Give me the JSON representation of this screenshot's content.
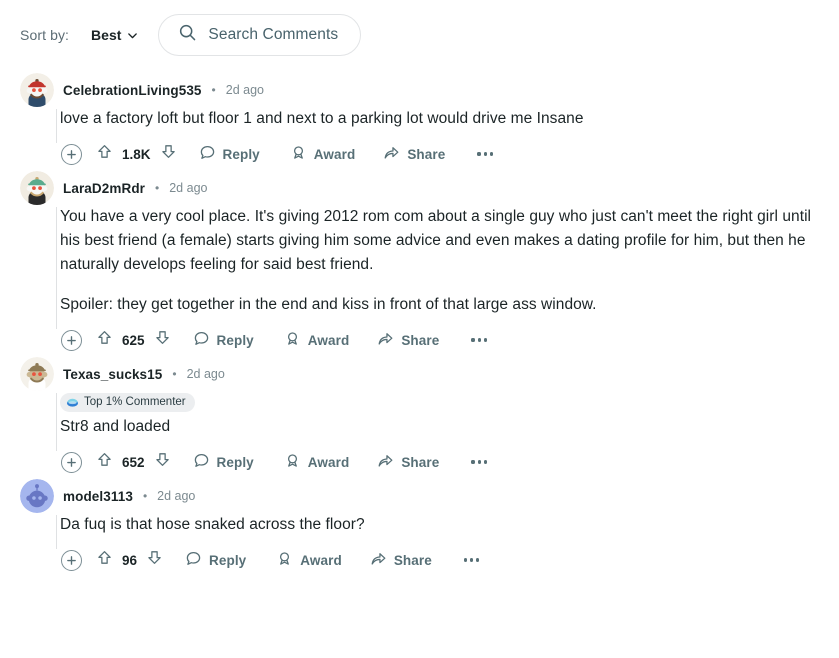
{
  "toolbar": {
    "sort_label": "Sort by:",
    "sort_value": "Best",
    "sort_chevron_icon": "chevron-down-icon",
    "search_icon": "search-icon",
    "search_placeholder": "Search Comments",
    "search_value": ""
  },
  "action_labels": {
    "reply": "Reply",
    "award": "Award",
    "share": "Share",
    "more": "more-options",
    "collapse": "collapse-thread",
    "upvote": "upvote-icon",
    "downvote": "downvote-icon"
  },
  "colors": {
    "text_primary": "#1b2426",
    "text_muted": "#576f76",
    "meta": "#7c8a90",
    "border": "#e2e4e6",
    "threadline": "#dfe1e3",
    "badge_bg": "#eceef0",
    "page_bg": "#ffffff"
  },
  "comments": [
    {
      "id": "c1",
      "author": "CelebrationLiving535",
      "separator": "•",
      "age": "2d ago",
      "badge": null,
      "paragraphs": [
        "love a factory loft but floor 1 and next to a parking lot would drive me Insane"
      ],
      "score": "1.8K",
      "avatar": {
        "name": "avatar-celebrationliving535",
        "bg": "#f3efe7",
        "body": "#2f4c6b",
        "skin": "#f6f6f4",
        "hat": "#c1342c",
        "hair": "#6b4b34"
      }
    },
    {
      "id": "c2",
      "author": "LaraD2mRdr",
      "separator": "•",
      "age": "2d ago",
      "badge": null,
      "paragraphs": [
        "You have a very cool place. It's giving 2012 rom com about a single guy who just can't meet the right girl until his best friend (a female) starts giving him some advice and even makes a dating profile for him, but then he naturally develops feeling for said best friend.",
        "Spoiler: they get together in the end and kiss in front of that large ass window."
      ],
      "score": "625",
      "avatar": {
        "name": "avatar-larad2mrdr",
        "bg": "#f1ece2",
        "body": "#2b2b2b",
        "skin": "#f7f7f5",
        "hat": "#5aab8e",
        "hair": "#c9a871"
      }
    },
    {
      "id": "c3",
      "author": "Texas_sucks15",
      "separator": "•",
      "age": "2d ago",
      "badge": {
        "label": "Top 1% Commenter",
        "icon": "top-commenter-icon"
      },
      "paragraphs": [
        "Str8 and loaded"
      ],
      "score": "652",
      "avatar": {
        "name": "avatar-texas-sucks15",
        "bg": "#f4f1ea",
        "body": "#ffffff",
        "skin": "#cbb894",
        "hat": "#8e7a55",
        "hair": "#8e7a55"
      }
    },
    {
      "id": "c4",
      "author": "model3113",
      "separator": "•",
      "age": "2d ago",
      "badge": null,
      "paragraphs": [
        "Da fuq is that hose snaked across the floor?"
      ],
      "score": "96",
      "avatar": {
        "name": "avatar-model3113",
        "bg": "#a5b6ee",
        "body": "#6877c4",
        "skin": "#6877c4",
        "hat": "#6877c4",
        "hair": "#6877c4"
      }
    }
  ]
}
